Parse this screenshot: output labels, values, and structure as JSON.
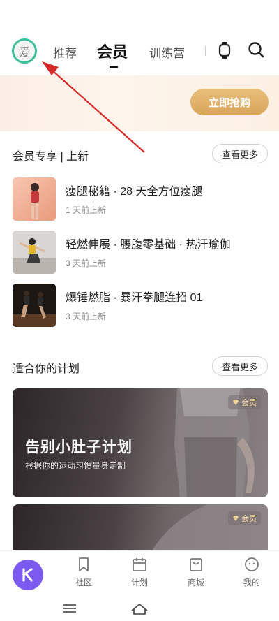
{
  "header": {
    "avatar_text": "爱",
    "tabs": [
      {
        "label": "推荐"
      },
      {
        "label": "会员"
      },
      {
        "label": "训练营"
      }
    ],
    "icons": [
      "watch-icon",
      "search-icon"
    ]
  },
  "banner": {
    "buy_label": "立即抢购"
  },
  "member_section": {
    "title": "会员专享 | 上新",
    "more_label": "查看更多",
    "courses": [
      {
        "title": "瘦腿秘籍 · 28 天全方位瘦腿",
        "sub": "1 天前上新"
      },
      {
        "title": "轻燃伸展 · 腰腹零基础 · 热汗瑜伽",
        "sub": "3 天前上新"
      },
      {
        "title": "爆锤燃脂 · 暴汗拳腿连招 01",
        "sub": "3 天前上新"
      }
    ]
  },
  "plan_section": {
    "title": "适合你的计划",
    "more_label": "查看更多",
    "cards": [
      {
        "title": "告别小肚子计划",
        "sub": "根据你的运动习惯量身定制",
        "badge": "会员"
      },
      {
        "title": "",
        "sub": "",
        "badge": "会员"
      }
    ]
  },
  "bottom_nav": {
    "items": [
      {
        "label": "社区",
        "icon": "bookmark-icon"
      },
      {
        "label": "计划",
        "icon": "calendar-icon"
      },
      {
        "label": "商城",
        "icon": "shop-icon"
      },
      {
        "label": "我的",
        "icon": "profile-icon"
      }
    ]
  },
  "colors": {
    "accent": "#7b5af0",
    "avatar_ring": "#3dbf9a",
    "buy_button": "#dfae66",
    "arrow": "#d62a2a"
  }
}
